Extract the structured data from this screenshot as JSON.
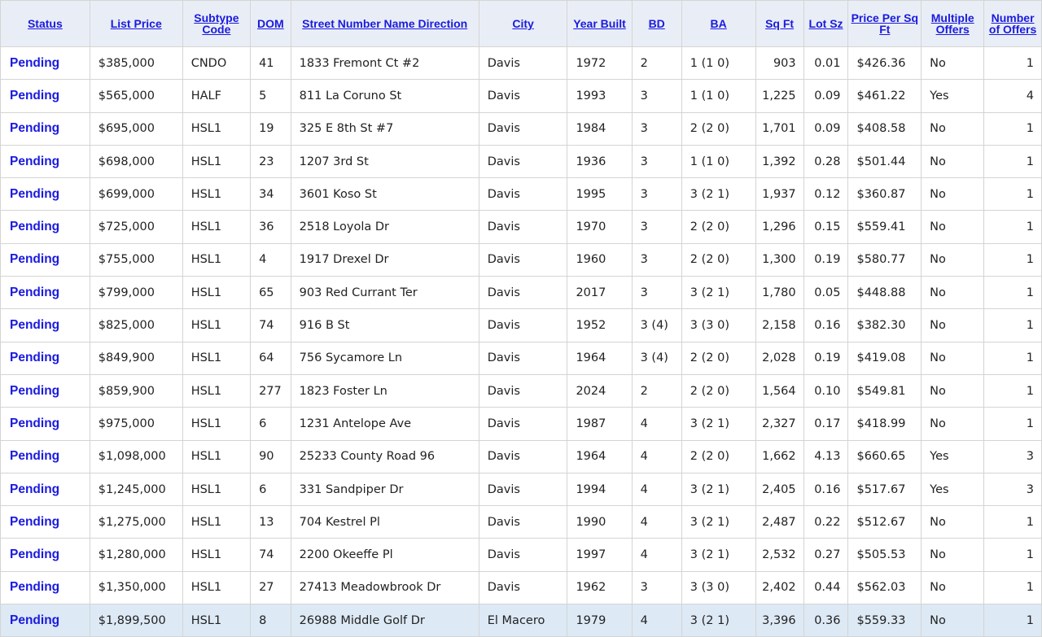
{
  "columns": [
    "Status",
    "List Price",
    "Subtype Code",
    "DOM",
    "Street Number Name Direction",
    "City",
    "Year Built",
    "BD",
    "BA",
    "Sq Ft",
    "Lot Sz",
    "Price Per Sq Ft",
    "Multiple Offers",
    "Number of Offers"
  ],
  "rows": [
    [
      "Pending",
      "$385,000",
      "CNDO",
      "41",
      "1833 Fremont Ct #2",
      "Davis",
      "1972",
      "2",
      "1 (1 0)",
      "903",
      "0.01",
      "$426.36",
      "No",
      "1"
    ],
    [
      "Pending",
      "$565,000",
      "HALF",
      "5",
      "811 La Coruno St",
      "Davis",
      "1993",
      "3",
      "1 (1 0)",
      "1,225",
      "0.09",
      "$461.22",
      "Yes",
      "4"
    ],
    [
      "Pending",
      "$695,000",
      "HSL1",
      "19",
      "325 E 8th St #7",
      "Davis",
      "1984",
      "3",
      "2 (2 0)",
      "1,701",
      "0.09",
      "$408.58",
      "No",
      "1"
    ],
    [
      "Pending",
      "$698,000",
      "HSL1",
      "23",
      "1207 3rd St",
      "Davis",
      "1936",
      "3",
      "1 (1 0)",
      "1,392",
      "0.28",
      "$501.44",
      "No",
      "1"
    ],
    [
      "Pending",
      "$699,000",
      "HSL1",
      "34",
      "3601 Koso St",
      "Davis",
      "1995",
      "3",
      "3 (2 1)",
      "1,937",
      "0.12",
      "$360.87",
      "No",
      "1"
    ],
    [
      "Pending",
      "$725,000",
      "HSL1",
      "36",
      "2518 Loyola Dr",
      "Davis",
      "1970",
      "3",
      "2 (2 0)",
      "1,296",
      "0.15",
      "$559.41",
      "No",
      "1"
    ],
    [
      "Pending",
      "$755,000",
      "HSL1",
      "4",
      "1917 Drexel Dr",
      "Davis",
      "1960",
      "3",
      "2 (2 0)",
      "1,300",
      "0.19",
      "$580.77",
      "No",
      "1"
    ],
    [
      "Pending",
      "$799,000",
      "HSL1",
      "65",
      "903 Red Currant Ter",
      "Davis",
      "2017",
      "3",
      "3 (2 1)",
      "1,780",
      "0.05",
      "$448.88",
      "No",
      "1"
    ],
    [
      "Pending",
      "$825,000",
      "HSL1",
      "74",
      "916 B St",
      "Davis",
      "1952",
      "3 (4)",
      "3 (3 0)",
      "2,158",
      "0.16",
      "$382.30",
      "No",
      "1"
    ],
    [
      "Pending",
      "$849,900",
      "HSL1",
      "64",
      "756 Sycamore Ln",
      "Davis",
      "1964",
      "3 (4)",
      "2 (2 0)",
      "2,028",
      "0.19",
      "$419.08",
      "No",
      "1"
    ],
    [
      "Pending",
      "$859,900",
      "HSL1",
      "277",
      "1823 Foster Ln",
      "Davis",
      "2024",
      "2",
      "2 (2 0)",
      "1,564",
      "0.10",
      "$549.81",
      "No",
      "1"
    ],
    [
      "Pending",
      "$975,000",
      "HSL1",
      "6",
      "1231 Antelope Ave",
      "Davis",
      "1987",
      "4",
      "3 (2 1)",
      "2,327",
      "0.17",
      "$418.99",
      "No",
      "1"
    ],
    [
      "Pending",
      "$1,098,000",
      "HSL1",
      "90",
      "25233 County Road 96",
      "Davis",
      "1964",
      "4",
      "2 (2 0)",
      "1,662",
      "4.13",
      "$660.65",
      "Yes",
      "3"
    ],
    [
      "Pending",
      "$1,245,000",
      "HSL1",
      "6",
      "331 Sandpiper Dr",
      "Davis",
      "1994",
      "4",
      "3 (2 1)",
      "2,405",
      "0.16",
      "$517.67",
      "Yes",
      "3"
    ],
    [
      "Pending",
      "$1,275,000",
      "HSL1",
      "13",
      "704 Kestrel Pl",
      "Davis",
      "1990",
      "4",
      "3 (2 1)",
      "2,487",
      "0.22",
      "$512.67",
      "No",
      "1"
    ],
    [
      "Pending",
      "$1,280,000",
      "HSL1",
      "74",
      "2200 Okeeffe Pl",
      "Davis",
      "1997",
      "4",
      "3 (2 1)",
      "2,532",
      "0.27",
      "$505.53",
      "No",
      "1"
    ],
    [
      "Pending",
      "$1,350,000",
      "HSL1",
      "27",
      "27413 Meadowbrook Dr",
      "Davis",
      "1962",
      "3",
      "3 (3 0)",
      "2,402",
      "0.44",
      "$562.03",
      "No",
      "1"
    ],
    [
      "Pending",
      "$1,899,500",
      "HSL1",
      "8",
      "26988 Middle Golf Dr",
      "El Macero",
      "1979",
      "4",
      "3 (2 1)",
      "3,396",
      "0.36",
      "$559.33",
      "No",
      "1"
    ]
  ]
}
